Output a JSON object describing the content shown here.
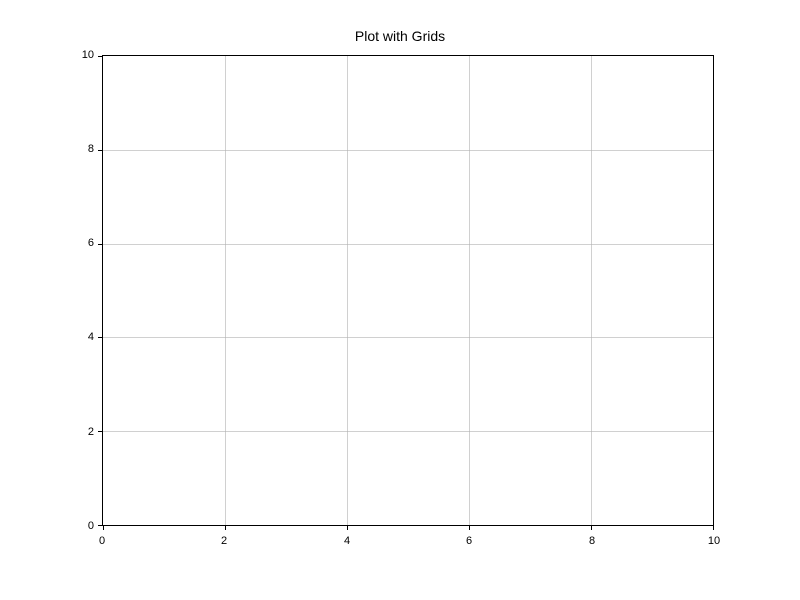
{
  "chart_data": {
    "type": "line",
    "title": "Plot with Grids",
    "xlabel": "",
    "ylabel": "",
    "xlim": [
      0,
      10
    ],
    "ylim": [
      0,
      10
    ],
    "x_ticks": [
      0,
      2,
      4,
      6,
      8,
      10
    ],
    "y_ticks": [
      0,
      2,
      4,
      6,
      8,
      10
    ],
    "x_tick_labels": [
      "0",
      "2",
      "4",
      "6",
      "8",
      "10"
    ],
    "y_tick_labels": [
      "0",
      "2",
      "4",
      "6",
      "8",
      "10"
    ],
    "grid": true,
    "series": []
  }
}
